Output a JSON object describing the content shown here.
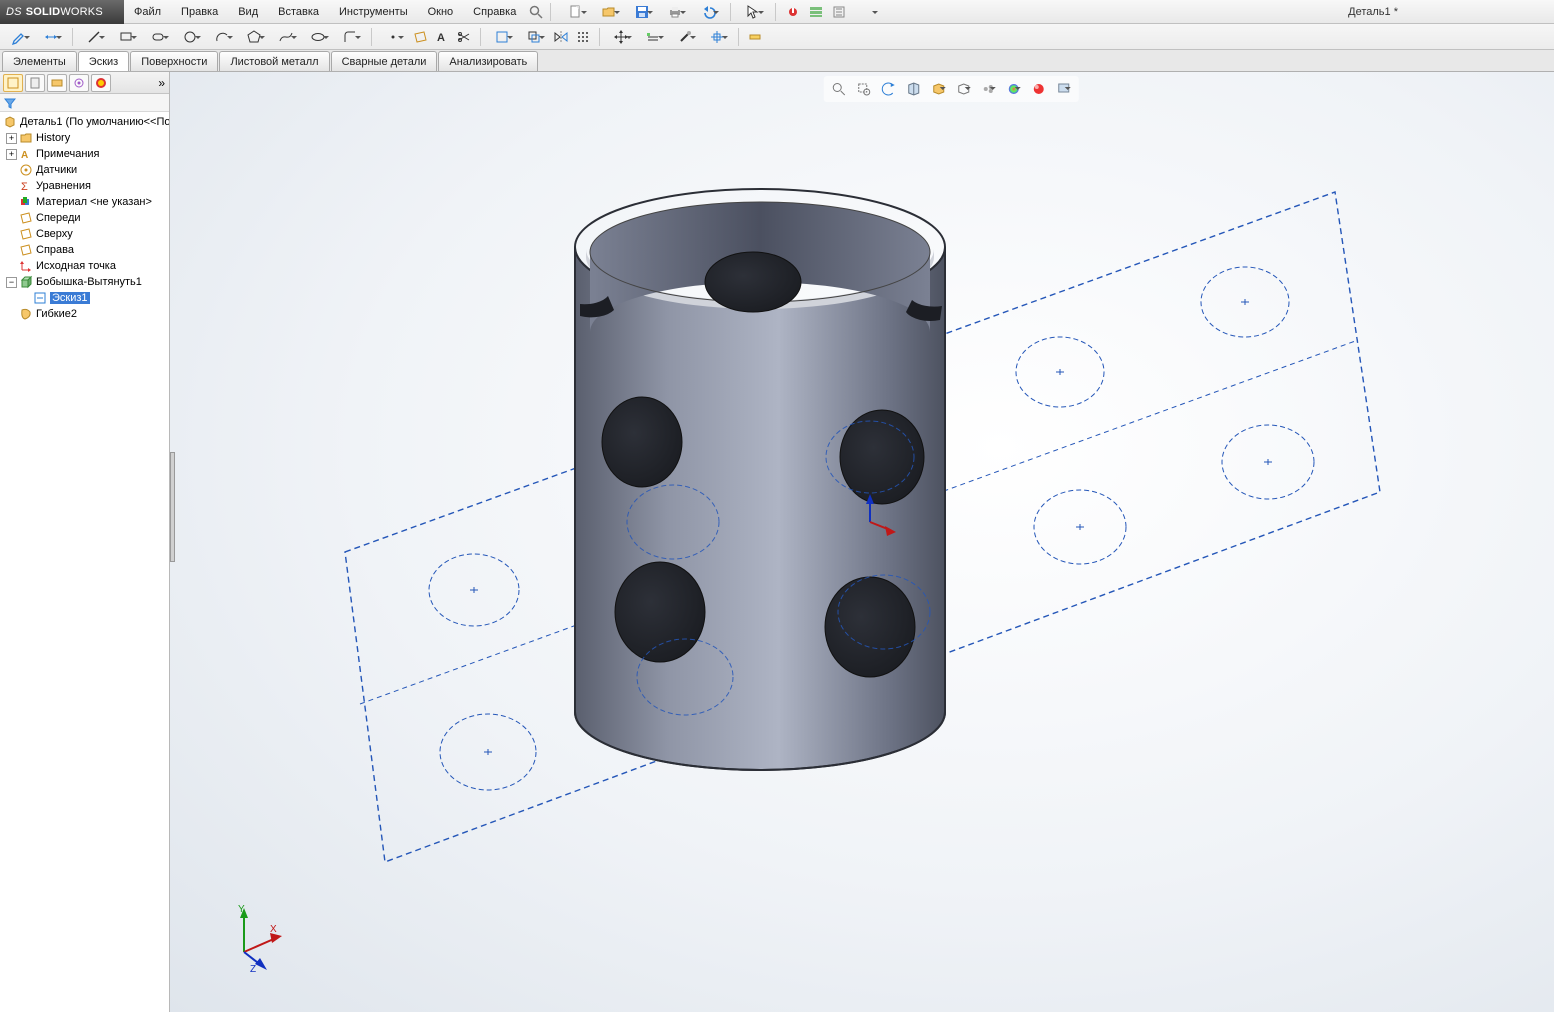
{
  "app": {
    "brand_prefix": "DS",
    "brand_solid": "SOLID",
    "brand_works": "WORKS"
  },
  "menu": {
    "file": "Файл",
    "edit": "Правка",
    "view": "Вид",
    "insert": "Вставка",
    "tools": "Инструменты",
    "window": "Окно",
    "help": "Справка"
  },
  "doc": {
    "title": "Деталь1 *"
  },
  "cmdtabs": {
    "elements": "Элементы",
    "sketch": "Эскиз",
    "surfaces": "Поверхности",
    "sheetmetal": "Листовой металл",
    "weldments": "Сварные детали",
    "analyze": "Анализировать"
  },
  "tree": {
    "root": "Деталь1  (По умолчанию<<По",
    "history": "History",
    "annotations": "Примечания",
    "sensors": "Датчики",
    "equations": "Уравнения",
    "material": "Материал <не указан>",
    "front": "Спереди",
    "top": "Сверху",
    "right": "Справа",
    "origin": "Исходная точка",
    "feat1": "Бобышка-Вытянуть1",
    "sketch1": "Эскиз1",
    "flex2": "Гибкие2"
  },
  "triad": {
    "x": "X",
    "y": "Y",
    "z": "Z"
  }
}
